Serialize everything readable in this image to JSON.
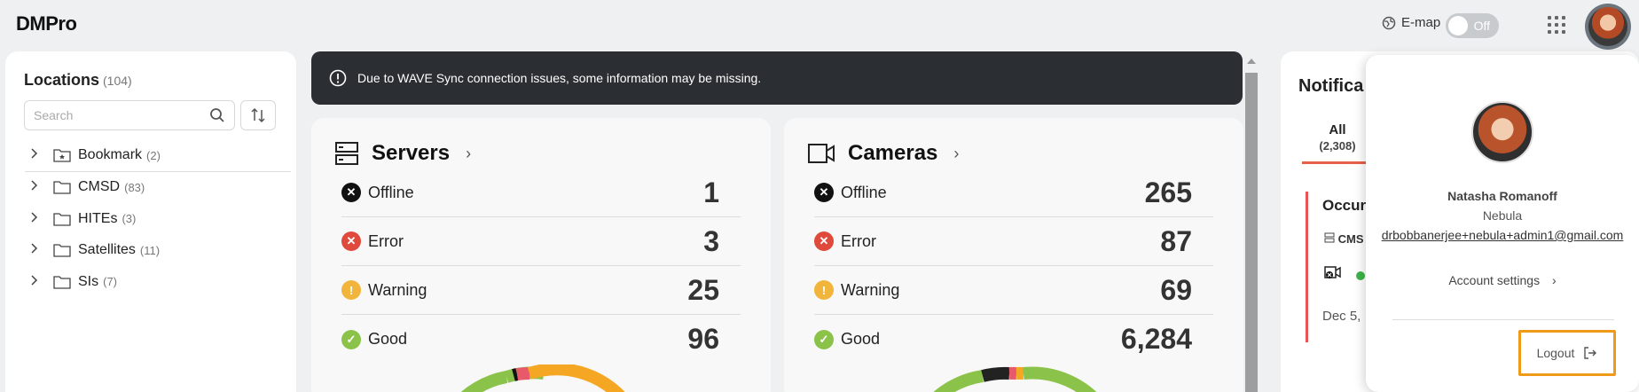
{
  "app": {
    "title": "DMPro"
  },
  "header": {
    "emap_label": "E-map",
    "toggle_label": "Off",
    "grid_icon": "apps-grid-icon",
    "avatar_icon": "user-avatar"
  },
  "locations": {
    "title": "Locations",
    "count": "(104)",
    "search_placeholder": "Search",
    "items": [
      {
        "label": "Bookmark",
        "count": "(2)",
        "icon": "bookmark-folder-icon"
      },
      {
        "label": "CMSD",
        "count": "(83)",
        "icon": "folder-icon"
      },
      {
        "label": "HITEs",
        "count": "(3)",
        "icon": "folder-icon"
      },
      {
        "label": "Satellites",
        "count": "(11)",
        "icon": "folder-icon"
      },
      {
        "label": "SIs",
        "count": "(7)",
        "icon": "folder-icon"
      }
    ]
  },
  "banner": {
    "message": "Due to WAVE Sync connection issues, some information may be missing."
  },
  "servers": {
    "title": "Servers",
    "stats": [
      {
        "label": "Offline",
        "value": "1"
      },
      {
        "label": "Error",
        "value": "3"
      },
      {
        "label": "Warning",
        "value": "25"
      },
      {
        "label": "Good",
        "value": "96"
      }
    ]
  },
  "cameras": {
    "title": "Cameras",
    "stats": [
      {
        "label": "Offline",
        "value": "265"
      },
      {
        "label": "Error",
        "value": "87"
      },
      {
        "label": "Warning",
        "value": "69"
      },
      {
        "label": "Good",
        "value": "6,284"
      }
    ]
  },
  "notifications": {
    "title": "Notifica",
    "tab_all": "All",
    "tab_all_count": "(2,308)",
    "item_title": "Occur",
    "item_cms": "CMS",
    "item_date": "Dec 5,"
  },
  "profile": {
    "name": "Natasha Romanoff",
    "org": "Nebula",
    "email": "drbobbanerjee+nebula+admin1@gmail.com",
    "account_settings": "Account settings",
    "logout": "Logout"
  },
  "colors": {
    "offline": "#111111",
    "error": "#e04a3c",
    "warning": "#f0b53a",
    "good": "#8bc34a",
    "highlight": "#f09a1a"
  }
}
